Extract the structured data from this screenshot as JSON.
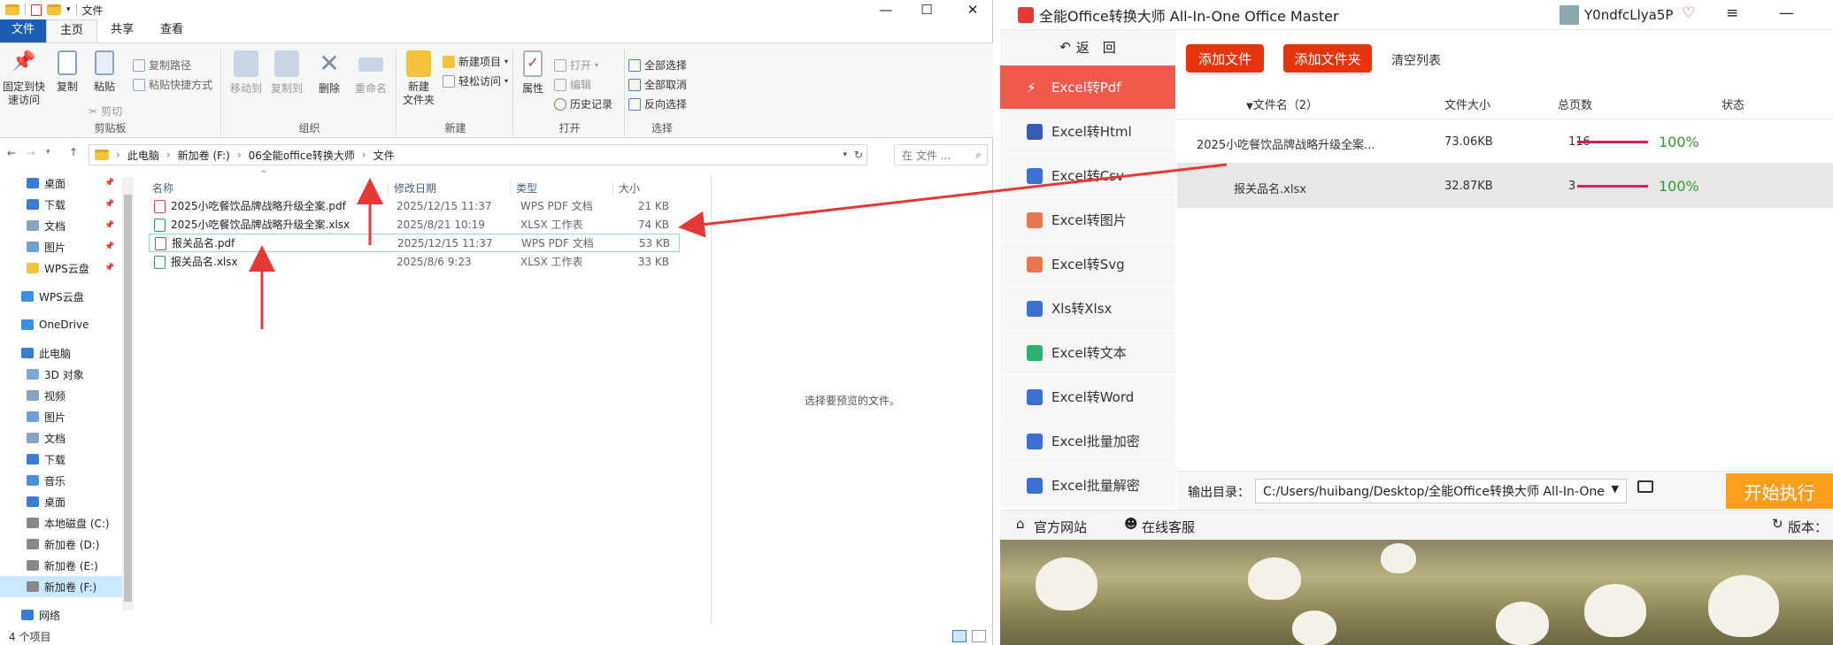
{
  "explorer": {
    "window_title": "文件",
    "tabs": [
      "文件",
      "主页",
      "共享",
      "查看"
    ],
    "ribbon": {
      "clipboard": {
        "group": "剪贴板",
        "pin_quick_access": "固定到快\n速访问",
        "copy": "复制",
        "paste": "粘贴",
        "copy_path": "复制路径",
        "paste_shortcut": "粘贴快捷方式",
        "cut": "剪切"
      },
      "organize": {
        "group": "组织",
        "move_to": "移动到",
        "copy_to": "复制到",
        "delete": "删除",
        "rename": "重命名"
      },
      "new": {
        "group": "新建",
        "new_folder": "新建\n文件夹",
        "new_item": "新建项目",
        "easy_access": "轻松访问"
      },
      "open": {
        "group": "打开",
        "properties": "属性",
        "open": "打开",
        "edit": "编辑",
        "history": "历史记录"
      },
      "select": {
        "group": "选择",
        "select_all": "全部选择",
        "select_none": "全部取消",
        "invert": "反向选择"
      }
    },
    "breadcrumb": [
      "此电脑",
      "新加卷 (F:)",
      "06全能office转换大师",
      "文件"
    ],
    "search_placeholder": "在 文件 ...",
    "nav": [
      {
        "label": "桌面",
        "pinned": true
      },
      {
        "label": "下载",
        "pinned": true
      },
      {
        "label": "文档",
        "pinned": true
      },
      {
        "label": "图片",
        "pinned": true
      },
      {
        "label": "WPS云盘",
        "pinned": true
      },
      {
        "label": "WPS云盘",
        "pinned": false
      },
      {
        "label": "OneDrive",
        "pinned": false
      },
      {
        "label": "此电脑",
        "pinned": false
      },
      {
        "label": "3D 对象",
        "pinned": false
      },
      {
        "label": "视频",
        "pinned": false
      },
      {
        "label": "图片",
        "pinned": false
      },
      {
        "label": "文档",
        "pinned": false
      },
      {
        "label": "下载",
        "pinned": false
      },
      {
        "label": "音乐",
        "pinned": false
      },
      {
        "label": "桌面",
        "pinned": false
      },
      {
        "label": "本地磁盘 (C:)",
        "pinned": false
      },
      {
        "label": "新加卷 (D:)",
        "pinned": false
      },
      {
        "label": "新加卷 (E:)",
        "pinned": false
      },
      {
        "label": "新加卷 (F:)",
        "pinned": false
      },
      {
        "label": "网络",
        "pinned": false
      }
    ],
    "columns": {
      "name": "名称",
      "date": "修改日期",
      "type": "类型",
      "size": "大小"
    },
    "files": [
      {
        "name": "2025小吃餐饮品牌战略升级全案.pdf",
        "date": "2025/12/15 11:37",
        "type": "WPS PDF 文档",
        "size": "21 KB"
      },
      {
        "name": "2025小吃餐饮品牌战略升级全案.xlsx",
        "date": "2025/8/21 10:19",
        "type": "XLSX 工作表",
        "size": "74 KB"
      },
      {
        "name": "报关品名.pdf",
        "date": "2025/12/15 11:37",
        "type": "WPS PDF 文档",
        "size": "53 KB"
      },
      {
        "name": "报关品名.xlsx",
        "date": "2025/8/6 9:23",
        "type": "XLSX 工作表",
        "size": "33 KB"
      }
    ],
    "preview_text": "选择要预览的文件。",
    "status": "4 个项目"
  },
  "converter": {
    "title": "全能Office转换大师 All-In-One Office Master",
    "user": "Y0ndfcLlya5P",
    "back": "返　回",
    "menu": [
      "Excel转Pdf",
      "Excel转Html",
      "Excel转Csv",
      "Excel转图片",
      "Excel转Svg",
      "Xls转Xlsx",
      "Excel转文本",
      "Excel转Word",
      "Excel批量加密",
      "Excel批量解密"
    ],
    "menu_icon_colors": [
      "#ffffff",
      "#3b5bb5",
      "#3b6fd1",
      "#e8774f",
      "#e8774f",
      "#3b6fd1",
      "#2fb36c",
      "#3b6fd1",
      "#3b6fd1",
      "#3b6fd1"
    ],
    "buttons": {
      "add_file": "添加文件",
      "add_folder": "添加文件夹",
      "clear": "清空列表"
    },
    "table_headers": {
      "name": "文件名（2）",
      "size": "文件大小",
      "pages": "总页数",
      "status": "状态"
    },
    "rows": [
      {
        "name": "2025小吃餐饮品牌战略升级全案...",
        "size": "73.06KB",
        "pages": "116",
        "progress": "100%"
      },
      {
        "name": "报关品名.xlsx",
        "size": "32.87KB",
        "pages": "3",
        "progress": "100%"
      }
    ],
    "output_label": "输出目录：",
    "output_path": "C:/Users/huibang/Desktop/全能Office转换大师 All-In-One",
    "start": "开始执行",
    "footer": {
      "site": "官方网站",
      "support": "在线客服",
      "version": "版本："
    },
    "accent": "#ee5b4d",
    "button_red": "#e8340d",
    "start_orange": "#ff9d1c"
  }
}
